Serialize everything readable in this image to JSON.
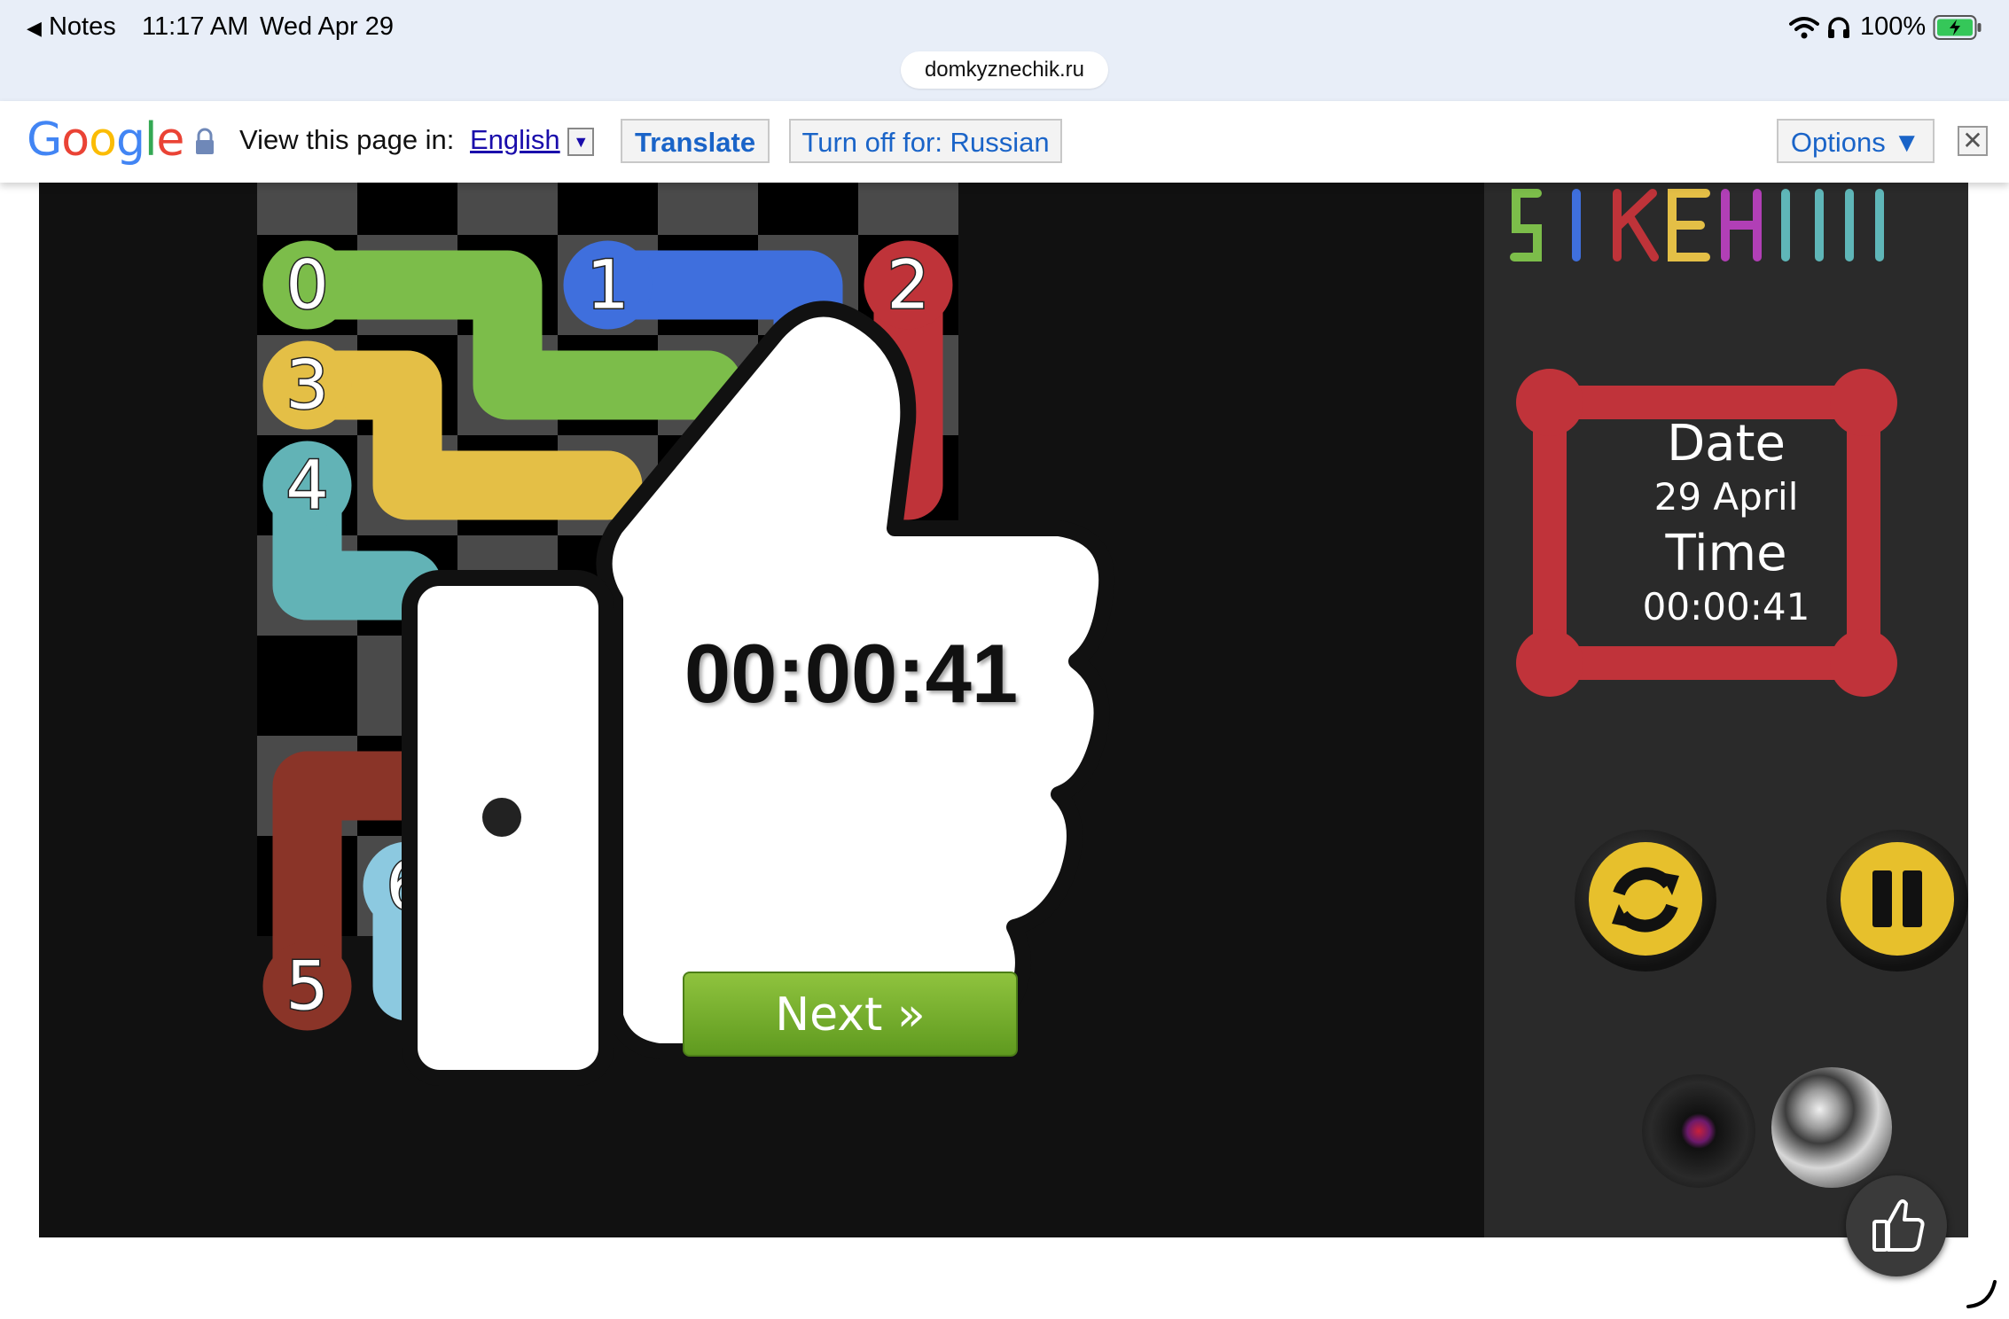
{
  "status_bar": {
    "back_app": "Notes",
    "time": "11:17 AM",
    "date": "Wed Apr 29",
    "battery": "100%",
    "url": "domkyznechik.ru"
  },
  "translate_bar": {
    "logo": "Google",
    "prompt": "View this page in:",
    "language": "English",
    "translate_label": "Translate",
    "turn_off_label": "Turn off for: Russian",
    "options_label": "Options ▼"
  },
  "board": {
    "pairs": [
      "0",
      "1",
      "2",
      "3",
      "4",
      "5",
      "6"
    ],
    "colors": {
      "0": "#7cbd4a",
      "1": "#3f6fdd",
      "2": "#bf3339",
      "3": "#e4bf46",
      "4": "#62b3b6",
      "5": "#8a3428",
      "6": "#8cc9e0"
    }
  },
  "win_popup": {
    "time": "00:00:41",
    "next_label": "Next »"
  },
  "sidebar": {
    "date_label": "Date",
    "date_value": "29 April",
    "time_label": "Time",
    "time_value": "00:00:41",
    "frame_color": "#c0333a",
    "button_color": "#e7c02c"
  }
}
